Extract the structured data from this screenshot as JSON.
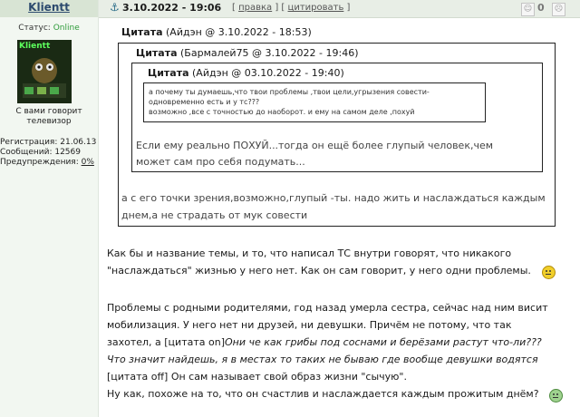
{
  "user": {
    "name": "Klientt",
    "status_label": "Статус:",
    "status_value": "Online",
    "avatar_text": "Klientt",
    "title_line1": "С вами говорит",
    "title_line2": "телевизор",
    "reg_label": "Регистрация:",
    "reg_value": "21.06.13",
    "posts_label": "Сообщений:",
    "posts_value": "12569",
    "warn_label": "Предупреждения:",
    "warn_value": "0%"
  },
  "header": {
    "date": "3.10.2022 - 19:06",
    "edit_link": "правка",
    "quote_link": "цитировать",
    "rating": "0"
  },
  "quote1": {
    "label": "Цитата",
    "meta": "(Айдэн @ 3.10.2022 - 18:53)"
  },
  "quote2": {
    "label": "Цитата",
    "meta": "(Бармалей75 @ 3.10.2022 - 19:46)"
  },
  "quote3": {
    "label": "Цитата",
    "meta": "(Айдэн @ 03.10.2022 - 19:40)",
    "lines": [
      "а почему ты думаешь,что твои проблемы ,твои цели,угрызения совести-",
      "одновременно есть и у тс???",
      "возможно ,все с точностью до наоборот. и ему на самом деле ,похуй"
    ]
  },
  "quote2_body": [
    "Если ему реально ПОХУЙ...тогда он ещё более глупый человек,чем",
    "может сам про себя подумать..."
  ],
  "quote1_body": [
    "а с его точки зрения,возможно,глупый -ты. надо жить и наслаждаться каждым",
    "днем,а не страдать от мук совести"
  ],
  "para1": [
    "Как бы и название темы, и то, что написал ТС внутри говорят, что никакого",
    "\"наслаждаться\" жизнью у него нет. Как он сам говорит, у него одни проблемы."
  ],
  "para2": {
    "line1": "Проблемы с родными родителями, год назад умерла сестра, сейчас над ним висит",
    "line2": "мобилизация. У него нет ни друзей, ни девушки. Причём не потому, что так",
    "line3_plain": "захотел, а [цитата on]",
    "line3_italic": "Они че как грибы под соснами и берёзами растут что-ли???",
    "line4_italic": "Что значит найдешь, я в местах то таких не бываю где вообще девушки водятся",
    "line5": "[цитата off] Он сам называет свой образ жизни \"сычую\".",
    "line6": "Ну как, похоже на то, что он счастлив и наслаждается каждым прожитым днём?"
  }
}
